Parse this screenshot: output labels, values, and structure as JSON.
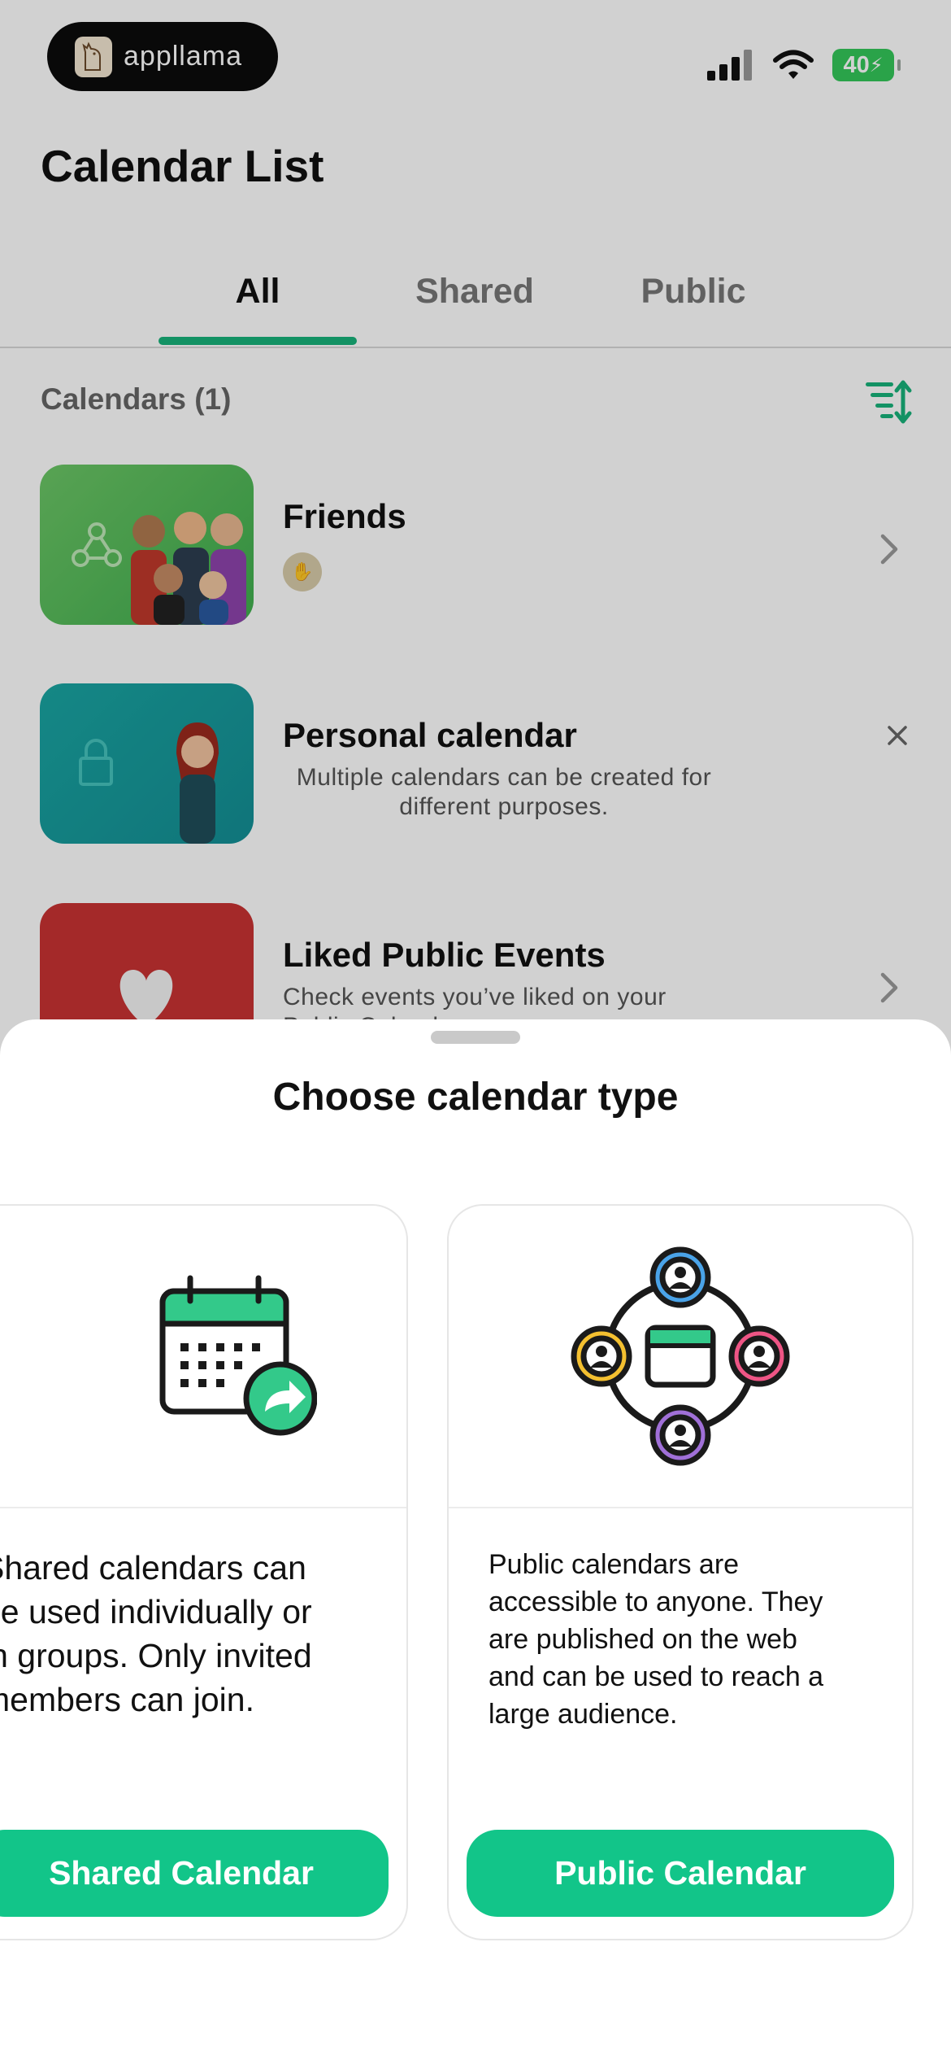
{
  "status_bar": {
    "brand": "appllama",
    "battery": "40"
  },
  "page": {
    "title": "Calendar List"
  },
  "tabs": [
    {
      "label": "All"
    },
    {
      "label": "Shared"
    },
    {
      "label": "Public"
    }
  ],
  "section": {
    "heading": "Calendars (1)"
  },
  "calendars": [
    {
      "title": "Friends",
      "subtitle": ""
    },
    {
      "title": "Personal calendar",
      "subtitle_line1": "Multiple calendars can be created for",
      "subtitle_line2": "different purposes."
    },
    {
      "title": "Liked Public Events",
      "subtitle_line1": "Check events you’ve liked on your",
      "subtitle_line2": "Public Calendar"
    }
  ],
  "sheet": {
    "title": "Choose calendar type",
    "cards": [
      {
        "desc_line1": "Shared calendars can",
        "desc_line2": "be used individually or",
        "desc_line3": "in groups. Only invited",
        "desc_line4": "members can join.",
        "button": "Shared Calendar"
      },
      {
        "desc_line1": "Public calendars are",
        "desc_line2": "accessible to anyone. They",
        "desc_line3": "are published on the web",
        "desc_line4": "and can be used to reach a",
        "desc_line5": "large audience.",
        "button": "Public Calendar"
      }
    ]
  },
  "colors": {
    "accent": "#12c589",
    "tab_indicator": "#18b27a",
    "friends_thumb": "#5fbf5a",
    "personal_thumb": "#1a9aa0",
    "liked_thumb": "#c83333",
    "battery": "#34c759"
  },
  "icons": [
    "llama-logo-icon",
    "cellular-signal-icon",
    "wifi-icon",
    "battery-icon",
    "sort-icon",
    "chevron-right-icon",
    "close-icon",
    "share-calendar-icon",
    "public-network-icon",
    "lock-icon",
    "heart-icon",
    "network-nodes-icon"
  ]
}
